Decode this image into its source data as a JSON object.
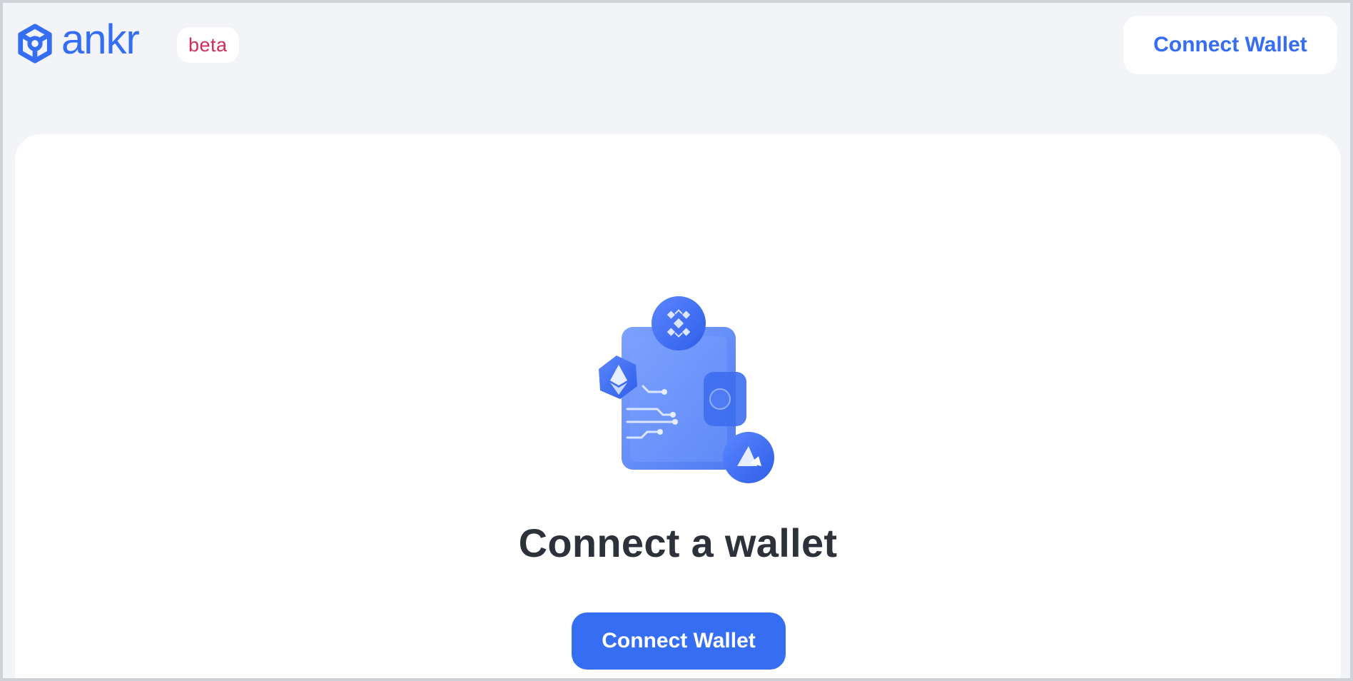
{
  "brand": {
    "name": "ankr",
    "badge": "beta",
    "logo_icon": "ankr-hexagon-icon",
    "accent_color": "#356df3",
    "badge_color": "#d22c5a"
  },
  "header": {
    "connect_button_label": "Connect Wallet"
  },
  "main": {
    "illustration": "wallet-crypto-coins-illustration",
    "title": "Connect a wallet",
    "cta_label": "Connect Wallet",
    "cta_color": "#356df3"
  }
}
